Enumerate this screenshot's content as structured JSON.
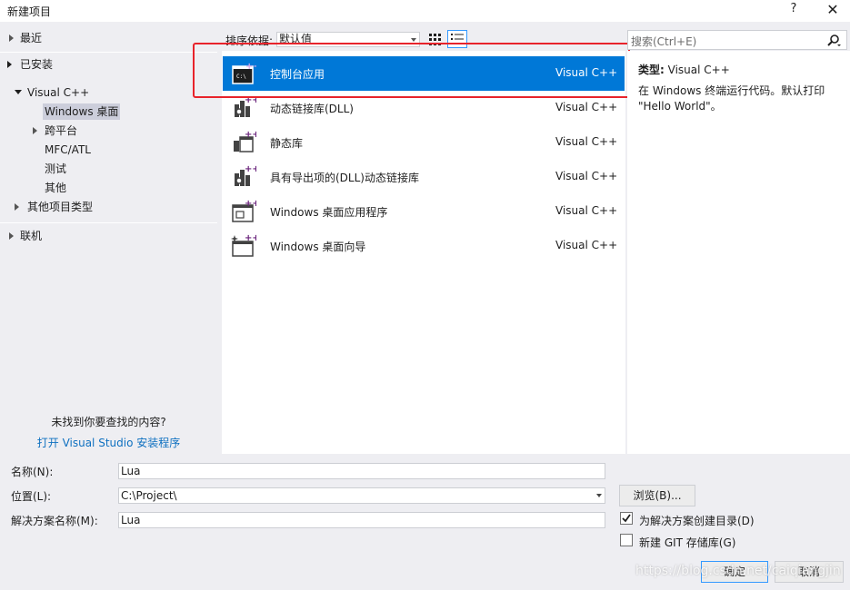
{
  "window": {
    "title": "新建项目",
    "help_label": "?",
    "close_label": "✕"
  },
  "tree": {
    "recent": "最近",
    "installed": "已安装",
    "visual_cpp": "Visual C++",
    "windows_desktop": "Windows 桌面",
    "cross_platform": "跨平台",
    "mfc_atl": "MFC/ATL",
    "test": "测试",
    "other": "其他",
    "other_project_types": "其他项目类型",
    "online": "联机"
  },
  "left_footer": {
    "not_found": "未找到你要查找的内容?",
    "open_installer": "打开 Visual Studio 安装程序"
  },
  "sort": {
    "label": "排序依据:",
    "value": "默认值"
  },
  "templates": [
    {
      "name": "控制台应用",
      "lang": "Visual C++",
      "icon": "console-app-icon"
    },
    {
      "name": "动态链接库(DLL)",
      "lang": "Visual C++",
      "icon": "dll-icon"
    },
    {
      "name": "静态库",
      "lang": "Visual C++",
      "icon": "static-lib-icon"
    },
    {
      "name": "具有导出项的(DLL)动态链接库",
      "lang": "Visual C++",
      "icon": "dll-exports-icon"
    },
    {
      "name": "Windows 桌面应用程序",
      "lang": "Visual C++",
      "icon": "desktop-app-icon"
    },
    {
      "name": "Windows 桌面向导",
      "lang": "Visual C++",
      "icon": "desktop-wizard-icon"
    }
  ],
  "search": {
    "placeholder": "搜索(Ctrl+E)"
  },
  "details": {
    "type_label": "类型:",
    "type_value": "Visual C++",
    "description": "在 Windows 终端运行代码。默认打印 \"Hello World\"。"
  },
  "form": {
    "name_label": "名称(N):",
    "name_value": "Lua",
    "location_label": "位置(L):",
    "location_value": "C:\\Project\\",
    "solution_label": "解决方案名称(M):",
    "solution_value": "Lua",
    "browse_label": "浏览(B)...",
    "create_dir_label": "为解决方案创建目录(D)",
    "create_dir_checked": true,
    "git_label": "新建 GIT 存储库(G)",
    "git_checked": false,
    "ok_label": "确定",
    "cancel_label": "取消"
  },
  "watermark": "https://blog.csdn.net/caiqiangjin",
  "colors": {
    "selection": "#0078d7",
    "highlight_box": "#e8232b",
    "link": "#0e70c0",
    "vs_purple": "#68217a"
  }
}
